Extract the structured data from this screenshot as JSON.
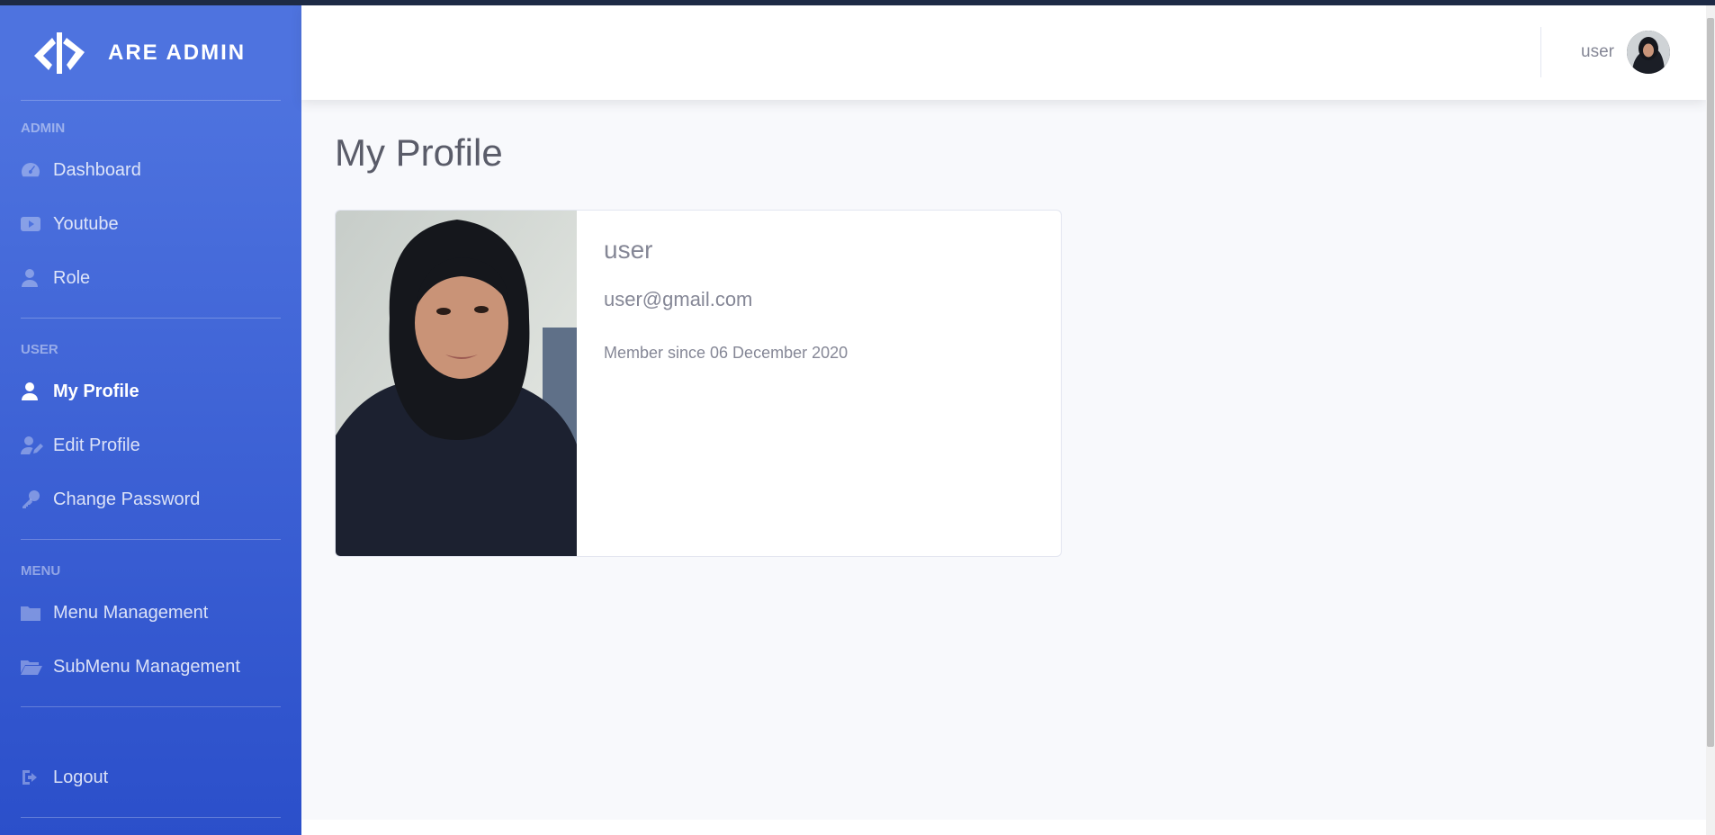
{
  "brand": {
    "name": "ARE ADMIN",
    "logo_icon": "code-slash-logo"
  },
  "sidebar": {
    "sections": [
      {
        "heading": "ADMIN",
        "items": [
          {
            "label": "Dashboard",
            "icon": "tachometer-icon"
          },
          {
            "label": "Youtube",
            "icon": "youtube-icon"
          },
          {
            "label": "Role",
            "icon": "user-tie-icon"
          }
        ]
      },
      {
        "heading": "USER",
        "items": [
          {
            "label": "My Profile",
            "icon": "user-icon",
            "active": true
          },
          {
            "label": "Edit Profile",
            "icon": "user-edit-icon"
          },
          {
            "label": "Change Password",
            "icon": "key-icon"
          }
        ]
      },
      {
        "heading": "MENU",
        "items": [
          {
            "label": "Menu Management",
            "icon": "folder-icon"
          },
          {
            "label": "SubMenu Management",
            "icon": "folder-open-icon"
          }
        ]
      }
    ],
    "logout": {
      "label": "Logout",
      "icon": "sign-out-icon"
    }
  },
  "topbar": {
    "username": "user"
  },
  "page": {
    "title": "My Profile"
  },
  "profile": {
    "name": "user",
    "email": "user@gmail.com",
    "member_since": "Member since 06 December 2020"
  },
  "colors": {
    "sidebar_start": "#4e73df",
    "sidebar_end": "#2b4fca",
    "text_muted": "#858796",
    "title": "#5a5c69"
  }
}
